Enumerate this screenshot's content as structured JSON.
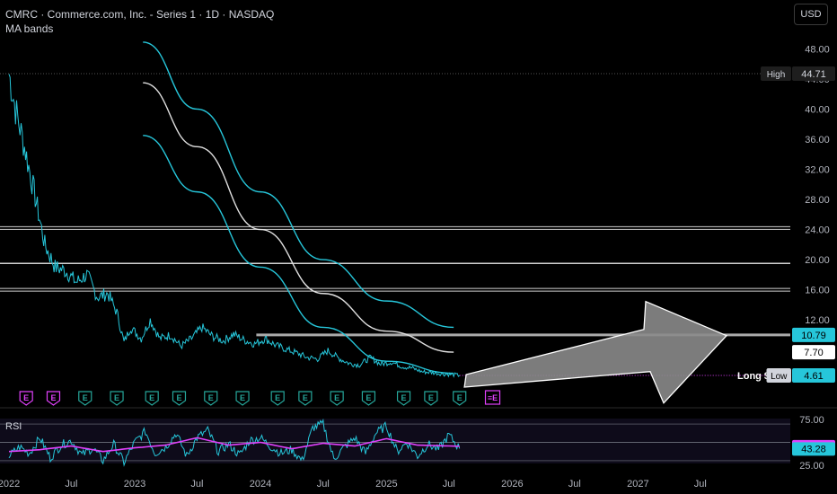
{
  "header": {
    "symbol_line": "CMRC · Commerce.com, Inc. - Series 1 · 1D · NASDAQ",
    "indicator": "MA bands"
  },
  "currency_button": "USD",
  "chart_data": [
    {
      "type": "line",
      "title": "CMRC · Commerce.com, Inc. - Series 1 · 1D · NASDAQ",
      "y_axis_ticks": [
        "48.00",
        "44.00",
        "40.00",
        "36.00",
        "32.00",
        "28.00",
        "24.00",
        "20.00",
        "16.00",
        "12.00"
      ],
      "ylim": [
        4,
        50
      ],
      "x_tick_labels": [
        "2022",
        "Jul",
        "2023",
        "Jul",
        "2024",
        "Jul",
        "2025",
        "Jul",
        "2026",
        "Jul",
        "2027",
        "Jul"
      ],
      "x_tick_dates": [
        "2022-01-01",
        "2022-07-01",
        "2023-01-01",
        "2023-07-01",
        "2024-01-01",
        "2024-07-01",
        "2025-01-01",
        "2025-07-01",
        "2026-01-01",
        "2026-07-01",
        "2027-01-01",
        "2027-07-01"
      ],
      "price_series": {
        "name": "CMRC",
        "color": "#26c6da",
        "x": [
          "2022-01-01",
          "2022-01-20",
          "2022-02-15",
          "2022-03-15",
          "2022-04-15",
          "2022-05-15",
          "2022-06-15",
          "2022-07-15",
          "2022-08-15",
          "2022-09-15",
          "2022-10-15",
          "2022-11-10",
          "2022-12-01",
          "2022-12-20",
          "2023-01-20",
          "2023-02-15",
          "2023-03-15",
          "2023-04-15",
          "2023-05-15",
          "2023-06-15",
          "2023-07-15",
          "2023-08-15",
          "2023-09-15",
          "2023-10-15",
          "2023-11-15",
          "2023-12-15",
          "2024-01-15",
          "2024-02-15",
          "2024-03-15",
          "2024-04-15",
          "2024-05-15",
          "2024-06-15",
          "2024-07-15",
          "2024-08-15",
          "2024-09-15",
          "2024-10-15",
          "2024-11-15",
          "2024-12-15",
          "2025-01-15",
          "2025-02-15",
          "2025-03-15",
          "2025-04-15",
          "2025-05-15",
          "2025-06-15",
          "2025-07-15",
          "2025-08-01"
        ],
        "values": [
          44.7,
          40,
          35,
          29,
          22,
          19,
          18.5,
          17,
          18,
          15,
          15.5,
          13,
          9,
          11,
          9.5,
          12,
          9.5,
          10,
          8.5,
          9.5,
          11,
          9.8,
          9.2,
          10.1,
          9.3,
          8.8,
          9.5,
          8.6,
          8.1,
          7.6,
          7,
          6.8,
          7.9,
          6.9,
          6.2,
          6,
          7,
          6.1,
          6.4,
          5.8,
          5.6,
          5.1,
          5,
          4.8,
          4.7,
          4.61
        ]
      },
      "ma_bands": [
        {
          "role": "upper",
          "color": "#26c6da",
          "x": [
            "2023-01-25",
            "2023-07-01",
            "2024-01-01",
            "2024-07-01",
            "2025-01-01",
            "2025-07-15"
          ],
          "values": [
            48.9,
            40,
            29,
            20,
            14.5,
            11
          ]
        },
        {
          "role": "middle",
          "color": "#e0e0e0",
          "x": [
            "2023-01-25",
            "2023-07-01",
            "2024-01-01",
            "2024-07-01",
            "2025-01-01",
            "2025-07-15"
          ],
          "values": [
            43.5,
            35,
            24,
            15.5,
            10.5,
            7.7
          ]
        },
        {
          "role": "lower",
          "color": "#26c6da",
          "x": [
            "2023-01-25",
            "2023-07-01",
            "2024-01-01",
            "2024-07-01",
            "2025-01-01",
            "2025-07-15"
          ],
          "values": [
            36.5,
            29,
            19,
            11,
            6.5,
            4.9
          ]
        }
      ],
      "horizontal_levels": [
        {
          "value": 44.71,
          "color": "#555555",
          "style": "dotted"
        },
        {
          "value": 24.2,
          "color": "#cfcfcf",
          "style": "double"
        },
        {
          "value": 19.5,
          "color": "#cfcfcf",
          "style": "solid"
        },
        {
          "value": 16.0,
          "color": "#cfcfcf",
          "style": "double"
        },
        {
          "value": 10.0,
          "color": "#aaaaaa",
          "style": "thick",
          "start": "2023-12-20"
        },
        {
          "value": 4.61,
          "color": "#e040fb",
          "style": "dotted",
          "start": "2025-08-01"
        }
      ],
      "price_labels": [
        {
          "tag": "High",
          "value": "44.71",
          "bg": "#1e1e1e",
          "fg": "#d1d4dc",
          "y": 44.71
        },
        {
          "value": "10.79",
          "bg": "#26c6da",
          "fg": "#000000",
          "y": 10.0
        },
        {
          "value": "7.70",
          "bg": "#ffffff",
          "fg": "#000000",
          "y": 7.7
        },
        {
          "tag": "Low",
          "value": "4.61",
          "bg": "#26c6da",
          "fg": "#000000",
          "y": 4.61
        }
      ],
      "annotation": {
        "text": "Long $",
        "color": "#ffffff"
      },
      "arrow": {
        "color": "#8a8a8a",
        "start_date": "2025-08-15",
        "start_value": 3.3,
        "end_date": "2027-09-15",
        "end_value": 9.9
      },
      "earnings_markers": {
        "label": "E",
        "past_color": "#26a69a",
        "early_color": "#e040fb",
        "future_label": "≡E",
        "dates": [
          "2022-02-20",
          "2022-05-10",
          "2022-08-10",
          "2022-11-10",
          "2023-02-20",
          "2023-05-10",
          "2023-08-10",
          "2023-11-10",
          "2024-02-20",
          "2024-05-10",
          "2024-08-10",
          "2024-11-10",
          "2025-02-20",
          "2025-05-10",
          "2025-08-01"
        ],
        "early_count": 2,
        "future_date": "2025-11-05"
      }
    },
    {
      "type": "line",
      "title": "RSI",
      "levels": [
        70,
        50,
        30
      ],
      "ylim": [
        20,
        80
      ],
      "y_axis_ticks": [
        "75.00",
        "25.00"
      ],
      "price_labels": [
        {
          "value": "45.73",
          "bg": "#e040fb",
          "fg": "#ffffff",
          "y": 45.73
        },
        {
          "value": "43.28",
          "bg": "#26c6da",
          "fg": "#000000",
          "y": 43.28
        }
      ],
      "series": [
        {
          "role": "rsi",
          "color": "#26c6da",
          "x": [
            "2022-01-01",
            "2022-02-01",
            "2022-03-01",
            "2022-04-01",
            "2022-05-01",
            "2022-06-01",
            "2022-07-01",
            "2022-08-01",
            "2022-09-01",
            "2022-10-01",
            "2022-11-01",
            "2022-12-01",
            "2023-01-01",
            "2023-02-01",
            "2023-03-01",
            "2023-04-01",
            "2023-05-01",
            "2023-06-01",
            "2023-07-01",
            "2023-08-01",
            "2023-09-01",
            "2023-10-01",
            "2023-11-01",
            "2023-12-01",
            "2024-01-01",
            "2024-02-01",
            "2024-03-01",
            "2024-04-01",
            "2024-05-01",
            "2024-06-01",
            "2024-07-01",
            "2024-08-01",
            "2024-09-01",
            "2024-10-01",
            "2024-11-01",
            "2024-12-01",
            "2025-01-01",
            "2025-02-01",
            "2025-03-01",
            "2025-04-01",
            "2025-05-01",
            "2025-06-01",
            "2025-07-01",
            "2025-08-01"
          ],
          "values": [
            35,
            45,
            38,
            55,
            33,
            47,
            52,
            36,
            44,
            30,
            48,
            28,
            50,
            62,
            38,
            45,
            60,
            35,
            55,
            63,
            40,
            48,
            36,
            52,
            55,
            45,
            38,
            42,
            30,
            66,
            70,
            32,
            45,
            55,
            38,
            60,
            68,
            40,
            50,
            35,
            48,
            42,
            58,
            43.28
          ]
        },
        {
          "role": "rsi_ma",
          "color": "#e040fb",
          "x": [
            "2022-01-01",
            "2022-04-01",
            "2022-07-01",
            "2022-10-01",
            "2023-01-01",
            "2023-04-01",
            "2023-07-01",
            "2023-10-01",
            "2024-01-01",
            "2024-04-01",
            "2024-07-01",
            "2024-10-01",
            "2025-01-01",
            "2025-04-01",
            "2025-08-01"
          ],
          "values": [
            40,
            42,
            46,
            40,
            44,
            47,
            55,
            47,
            50,
            43,
            49,
            46,
            54,
            47,
            45.73
          ]
        }
      ]
    }
  ]
}
